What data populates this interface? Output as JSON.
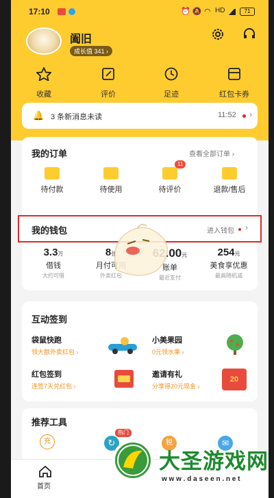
{
  "status_bar": {
    "time": "17:10",
    "net": "HD",
    "battery": "71"
  },
  "profile": {
    "name": "阖旧",
    "badge": "成长值 341 ›"
  },
  "quick_actions": [
    {
      "label": "收藏",
      "icon": "star-icon"
    },
    {
      "label": "评价",
      "icon": "edit-icon"
    },
    {
      "label": "足迹",
      "icon": "clock-icon"
    },
    {
      "label": "红包卡券",
      "icon": "coupon-icon"
    }
  ],
  "notification": {
    "text": "3 条新消息未读",
    "time": "11:52"
  },
  "orders": {
    "title": "我的订单",
    "link": "查看全部订单 ›",
    "items": [
      {
        "label": "待付款",
        "badge": ""
      },
      {
        "label": "待使用",
        "badge": ""
      },
      {
        "label": "待评价",
        "badge": "11"
      },
      {
        "label": "退款/售后",
        "badge": ""
      }
    ]
  },
  "wallet": {
    "title": "我的钱包",
    "link": "进入钱包",
    "stats": [
      {
        "value": "3.3",
        "unit": "万",
        "label": "借钱",
        "sub": "大约可借"
      },
      {
        "value": "8",
        "unit": "张",
        "label": "月付可用",
        "sub": "外卖红包"
      },
      {
        "value": "62.00",
        "unit": "元",
        "label": "账单",
        "sub": "最近支付"
      },
      {
        "value": "254",
        "unit": "元",
        "label": "美食享优惠",
        "sub": "最高随机减"
      }
    ]
  },
  "interactive": {
    "title": "互动签到",
    "cells": [
      {
        "title": "袋鼠快跑",
        "sub": "领大额外卖红包 ›"
      },
      {
        "title": "小美果园",
        "sub": "0元领水果 ›"
      },
      {
        "title": "红包签到",
        "sub": "连签7天兑红包 ›"
      },
      {
        "title": "邀请有礼",
        "sub": "分享得20元现金 ›"
      }
    ],
    "invite_amount": "20"
  },
  "tools": {
    "title": "推荐工具",
    "badge": "热门",
    "items": [
      {
        "label": "充",
        "icon": "recharge-icon"
      },
      {
        "label": "",
        "icon": "refresh-icon"
      },
      {
        "label": "税",
        "icon": "tax-icon"
      },
      {
        "label": "",
        "icon": "chat-icon"
      }
    ]
  },
  "tabbar": {
    "home_label": "首页"
  },
  "watermark": {
    "text": "大圣游戏网",
    "url": "w w w . d a s e e n . n e t"
  },
  "colors": {
    "brand": "#ffcc2f",
    "highlight": "#e02828",
    "accent": "#f0921e"
  }
}
